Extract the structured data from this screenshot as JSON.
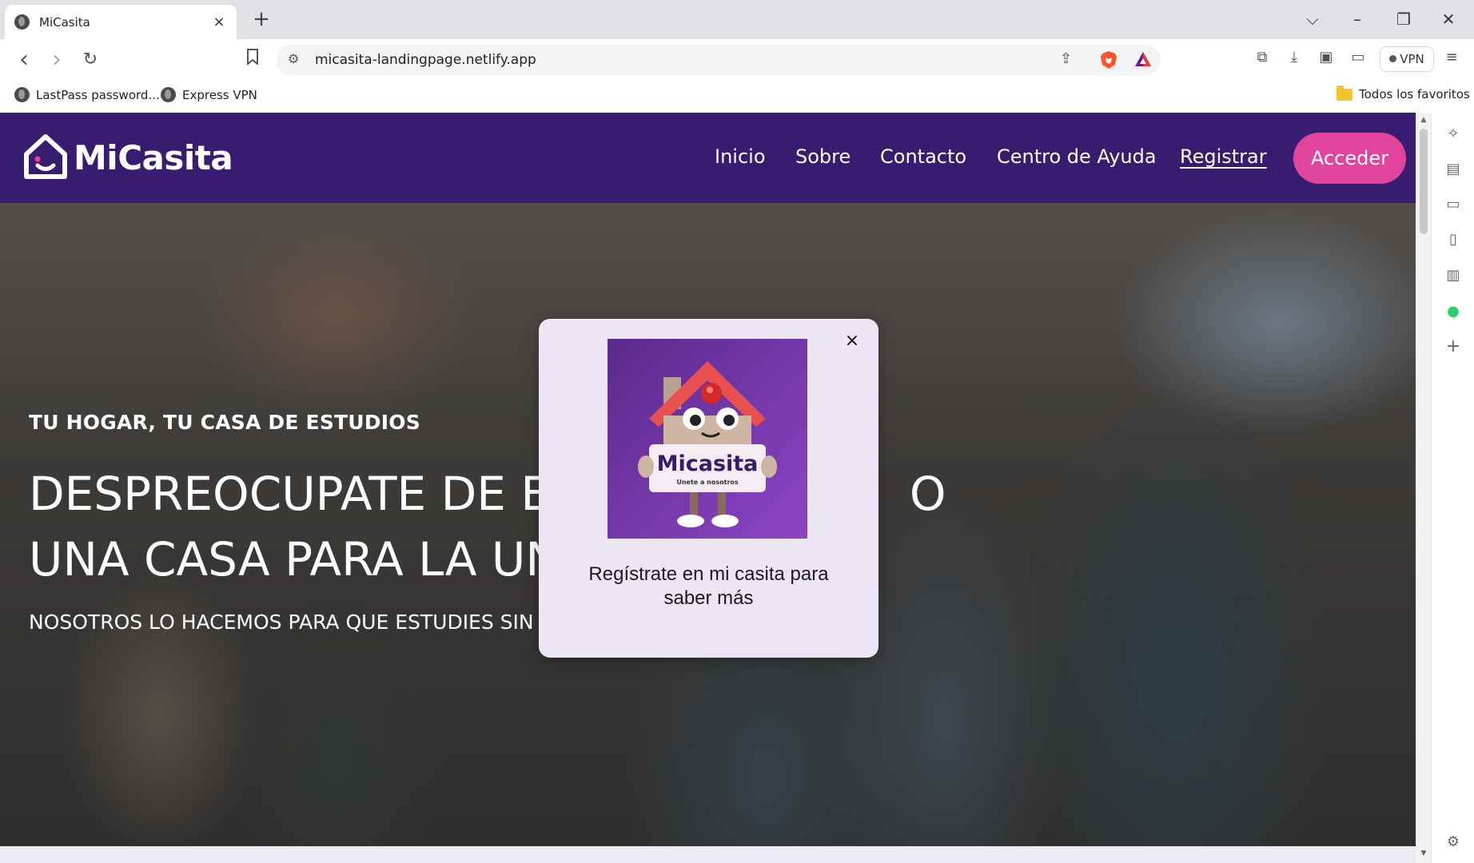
{
  "browser": {
    "tab": {
      "title": "MiCasita",
      "close": "×"
    },
    "new_tab": "+",
    "window": {
      "dropdown": "⌵",
      "minimize": "–",
      "restore": "❐",
      "close": "✕"
    },
    "nav": {
      "back": "‹",
      "forward": "›",
      "reload": "↻",
      "bookmark": "☆"
    },
    "url": "micasita-landingpage.netlify.app",
    "vpn_label": "VPN",
    "bookmarks": [
      {
        "label": "LastPass password..."
      },
      {
        "label": "Express VPN"
      }
    ],
    "bookmarks_folder": "Todos los favoritos",
    "brave_color": "#fb542b"
  },
  "site": {
    "brand": "MiCasita",
    "brand_color": "#381c70",
    "accent_color": "#e0449c",
    "nav": {
      "inicio": "Inicio",
      "sobre": "Sobre",
      "contacto": "Contacto",
      "ayuda": "Centro de Ayuda",
      "registrar": "Registrar"
    },
    "acceder": "Acceder"
  },
  "hero": {
    "kicker": "TU HOGAR, TU CASA DE ESTUDIOS",
    "headline_line1": "DESPREOCUPATE DE ES",
    "headline_line1_end": "O",
    "headline_line2": "UNA CASA PARA LA UN",
    "subline": "NOSOTROS LO HACEMOS PARA QUE ESTUDIES SIN P"
  },
  "modal": {
    "close": "×",
    "art_brand": "Micasita",
    "art_tagline": "Unete a nosotros",
    "message": "Regístrate en mi casita para saber más"
  }
}
